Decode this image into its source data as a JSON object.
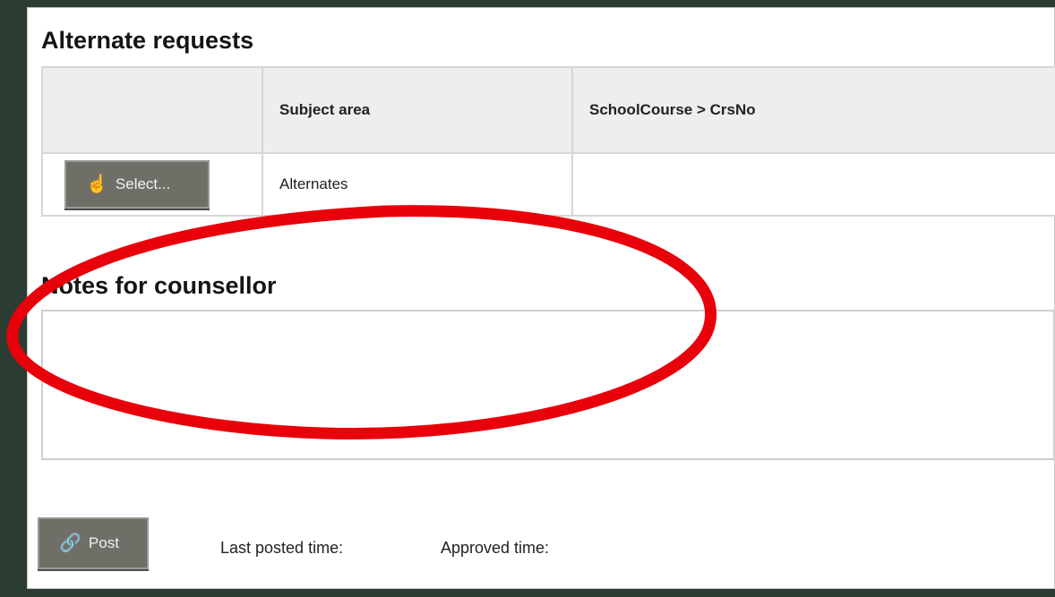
{
  "alternate_requests": {
    "title": "Alternate requests",
    "columns": [
      "",
      "Subject area",
      "SchoolCourse > CrsNo"
    ],
    "rows": [
      {
        "select_label": "Select...",
        "subject_area": "Alternates",
        "course": ""
      }
    ]
  },
  "notes": {
    "title": "Notes for counsellor",
    "value": ""
  },
  "footer": {
    "post_label": "Post",
    "last_posted_label": "Last posted time:",
    "approved_label": "Approved time:"
  },
  "colors": {
    "background": "#2b3d33",
    "button": "#6f6f68",
    "annotation_circle": "#e8000a"
  },
  "icons": {
    "select_button": "pointer-hand-icon",
    "post_button": "link-icon"
  }
}
